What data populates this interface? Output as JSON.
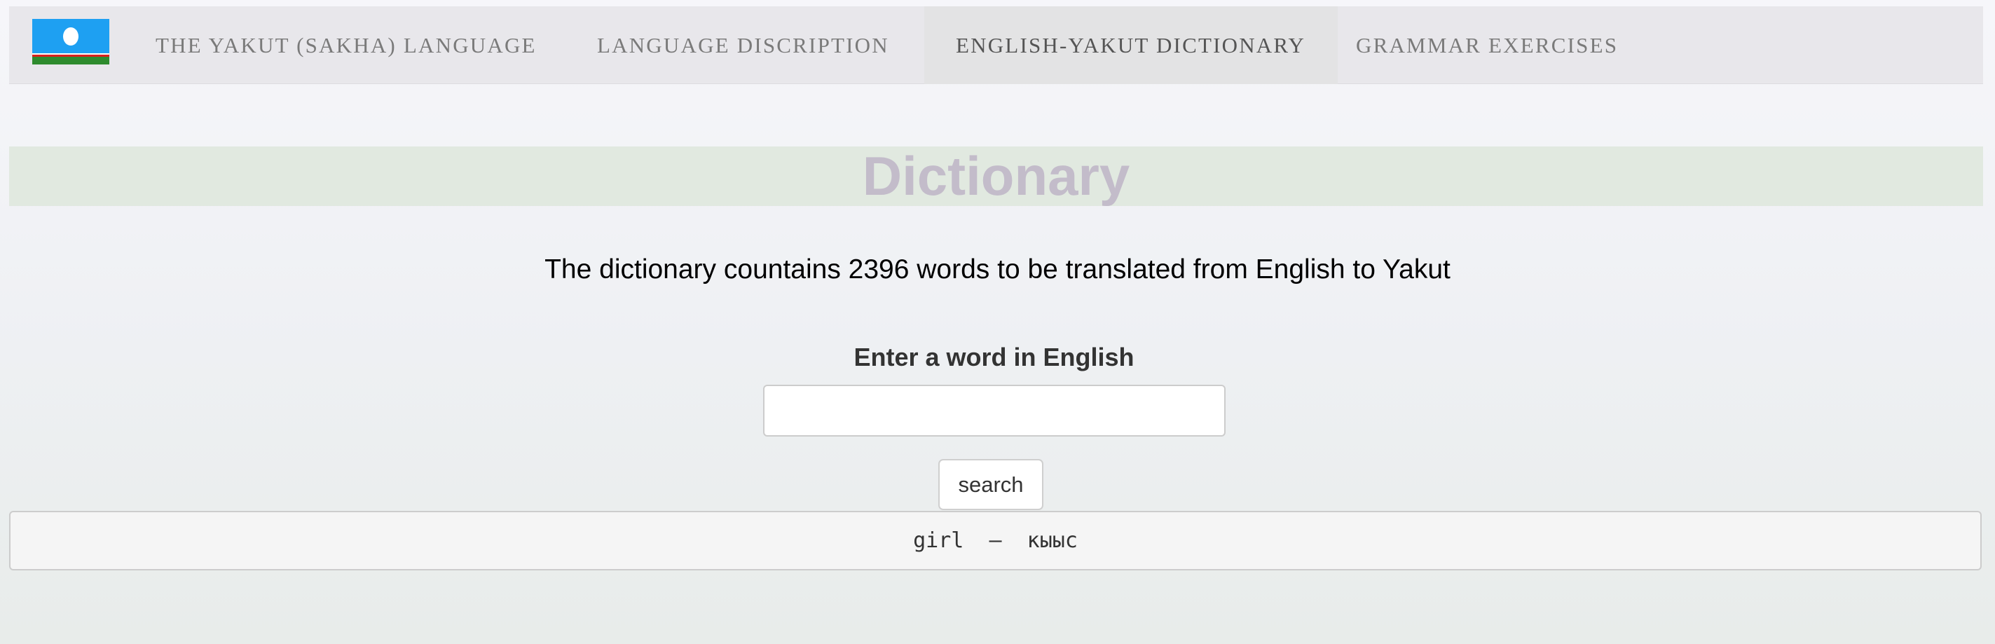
{
  "navbar": {
    "logo_icon": "sakha-flag-icon",
    "items": [
      {
        "label": "THE YAKUT (SAKHA) LANGUAGE",
        "active": false
      },
      {
        "label": "LANGUAGE DISCRIPTION",
        "active": false
      },
      {
        "label": "ENGLISH-YAKUT DICTIONARY",
        "active": true
      },
      {
        "label": "GRAMMAR EXERCISES",
        "active": false
      }
    ]
  },
  "main": {
    "title": "Dictionary",
    "description": "The dictionary countains 2396 words to be translated from English to Yakut",
    "input_label": "Enter a word in English",
    "input_value": "",
    "input_placeholder": "",
    "search_label": "search",
    "result": "girl  –  кыыс"
  },
  "colors": {
    "navbar_bg": "#e8e7eb",
    "active_nav_bg": "#e3e3e4",
    "title_band_bg": "#e1e9e0",
    "title_color": "#c3bcca",
    "flag_blue": "#1ea0f2",
    "flag_green": "#2e8b2e",
    "flag_red": "#d8211e"
  }
}
